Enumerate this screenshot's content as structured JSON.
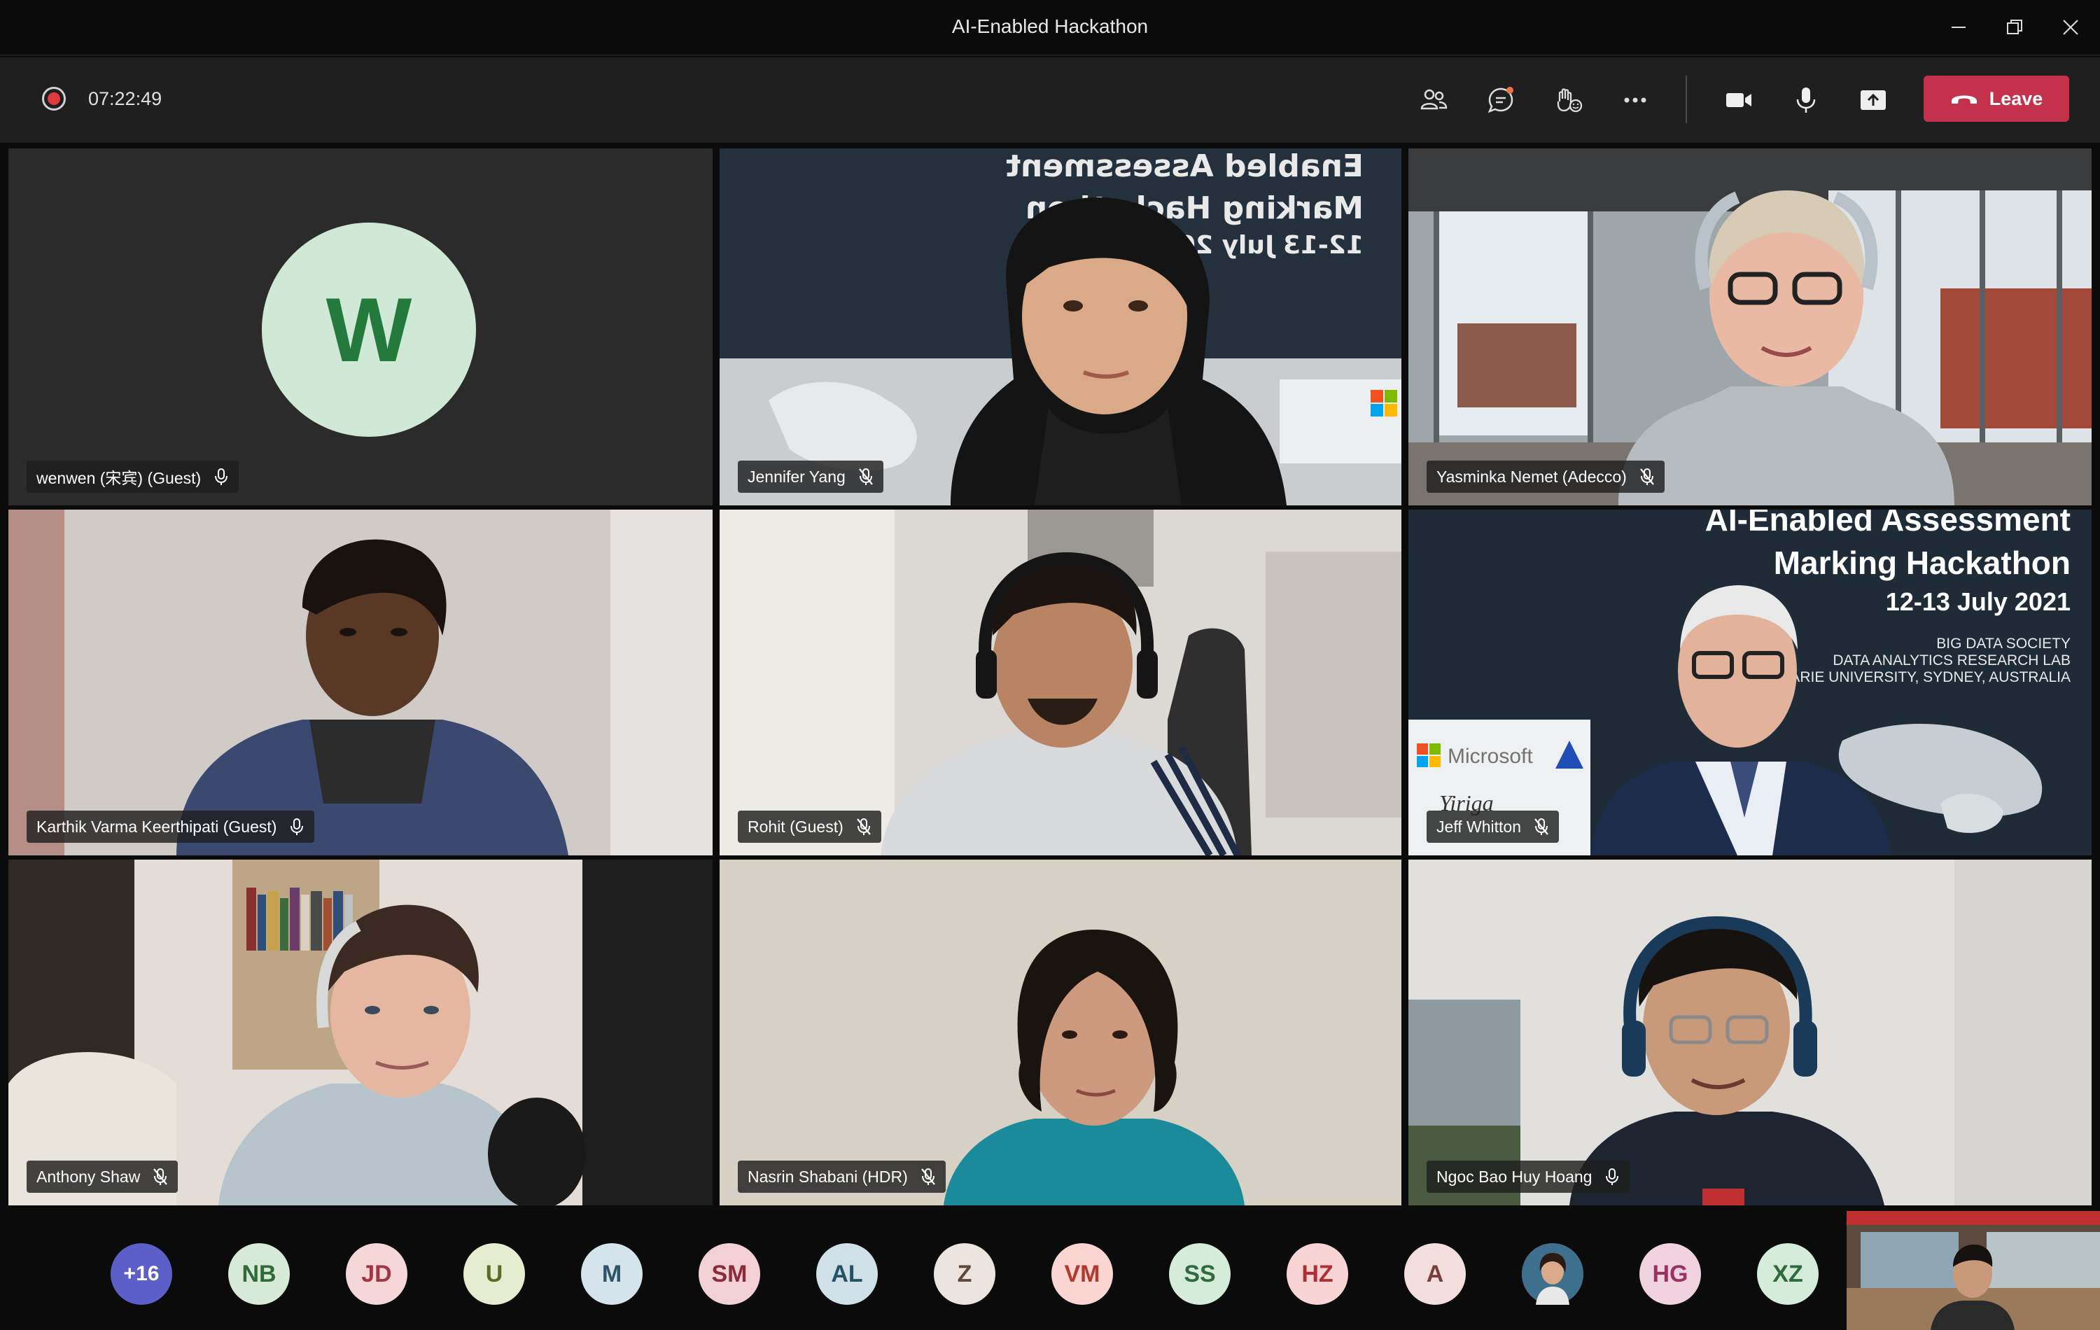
{
  "window": {
    "title": "AI-Enabled Hackathon"
  },
  "toolbar": {
    "timer": "07:22:49",
    "leave_label": "Leave",
    "icons": [
      "people-icon",
      "chat-icon",
      "reactions-icon",
      "more-icon",
      "camera-icon",
      "microphone-icon",
      "share-screen-icon"
    ]
  },
  "participants": [
    {
      "name": "wenwen (宋宾) (Guest)",
      "initial": "W",
      "mic": "on"
    },
    {
      "name": "Jennifer Yang",
      "mic": "muted"
    },
    {
      "name": "Yasminka Nemet (Adecco)",
      "mic": "muted"
    },
    {
      "name": "Karthik Varma Keerthipati (Guest)",
      "mic": "on"
    },
    {
      "name": "Rohit (Guest)",
      "mic": "muted"
    },
    {
      "name": "Jeff Whitton",
      "mic": "muted"
    },
    {
      "name": "Anthony Shaw",
      "mic": "muted"
    },
    {
      "name": "Nasrin Shabani (HDR)",
      "mic": "muted"
    },
    {
      "name": "Ngoc Bao Huy Hoang",
      "mic": "on"
    }
  ],
  "slide": {
    "line1": "AI-Enabled Assessment",
    "line2": "Marking Hackathon",
    "line3": "12-13 July 2021",
    "sub1": "BIG DATA SOCIETY",
    "sub2": "DATA ANALYTICS RESEARCH LAB",
    "sub3": "MACQUARIE UNIVERSITY, SYDNEY, AUSTRALIA",
    "logo_microsoft": "Microsoft",
    "logo_yiriga": "Yiriga"
  },
  "strip": {
    "more_count": "+16",
    "avatars": [
      {
        "initials": "NB",
        "bg": "#d6ead7",
        "fg": "#2f6b39"
      },
      {
        "initials": "JD",
        "bg": "#f6d7d9",
        "fg": "#a23744"
      },
      {
        "initials": "U",
        "bg": "#e5ecd0",
        "fg": "#5a6b24"
      },
      {
        "initials": "M",
        "bg": "#d5e3ea",
        "fg": "#2e5566"
      },
      {
        "initials": "SM",
        "bg": "#f2d0d6",
        "fg": "#8b2c3b"
      },
      {
        "initials": "AL",
        "bg": "#cfe0e6",
        "fg": "#245363"
      },
      {
        "initials": "Z",
        "bg": "#ece4de",
        "fg": "#5e4a3c"
      },
      {
        "initials": "VM",
        "bg": "#fad5d2",
        "fg": "#b03a2e"
      },
      {
        "initials": "SS",
        "bg": "#d6ecdb",
        "fg": "#2f6b3e"
      },
      {
        "initials": "HZ",
        "bg": "#f8d4d4",
        "fg": "#b02f35"
      },
      {
        "initials": "A",
        "bg": "#f3dede",
        "fg": "#7a3d3d"
      },
      {
        "initials": "",
        "bg": "#3e6f8c",
        "fg": "#ffffff"
      },
      {
        "initials": "HG",
        "bg": "#f1d3e0",
        "fg": "#9a3262"
      },
      {
        "initials": "XZ",
        "bg": "#d4ecd9",
        "fg": "#2f6b3c"
      }
    ]
  },
  "colors": {
    "leave": "#c4314b",
    "recording": "#e03a3e",
    "background": "#0b0b0b"
  }
}
